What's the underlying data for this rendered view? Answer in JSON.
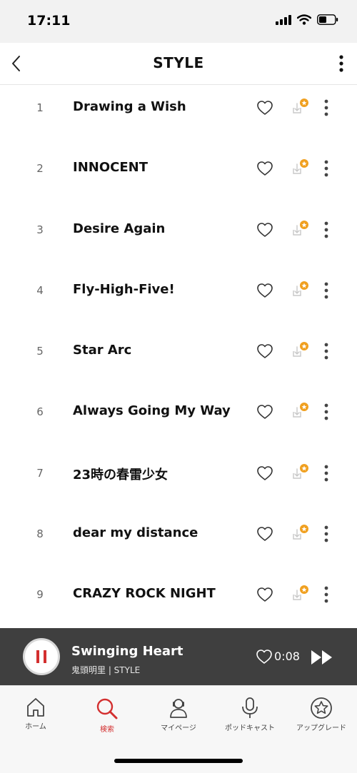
{
  "status": {
    "time": "17:11"
  },
  "header": {
    "title": "STYLE"
  },
  "tracks": [
    {
      "num": "1",
      "title": "Drawing a Wish"
    },
    {
      "num": "2",
      "title": "INNOCENT"
    },
    {
      "num": "3",
      "title": "Desire Again"
    },
    {
      "num": "4",
      "title": "Fly-High-Five!"
    },
    {
      "num": "5",
      "title": "Star Arc"
    },
    {
      "num": "6",
      "title": "Always Going My Way"
    },
    {
      "num": "7",
      "title": "23時の春雷少女"
    },
    {
      "num": "8",
      "title": "dear my distance"
    },
    {
      "num": "9",
      "title": "CRAZY ROCK NIGHT"
    }
  ],
  "now_playing": {
    "title": "Swinging Heart",
    "artist": "鬼頭明里 | STYLE",
    "time": "0:08"
  },
  "tabs": [
    {
      "label": "ホーム",
      "icon": "home-icon"
    },
    {
      "label": "検索",
      "icon": "search-icon"
    },
    {
      "label": "マイページ",
      "icon": "person-icon"
    },
    {
      "label": "ポッドキャスト",
      "icon": "microphone-icon"
    },
    {
      "label": "アップグレード",
      "icon": "star-icon"
    }
  ],
  "colors": {
    "accent": "#d32f2f",
    "badge": "#f0a020",
    "player_bg": "#3f3f3f"
  }
}
